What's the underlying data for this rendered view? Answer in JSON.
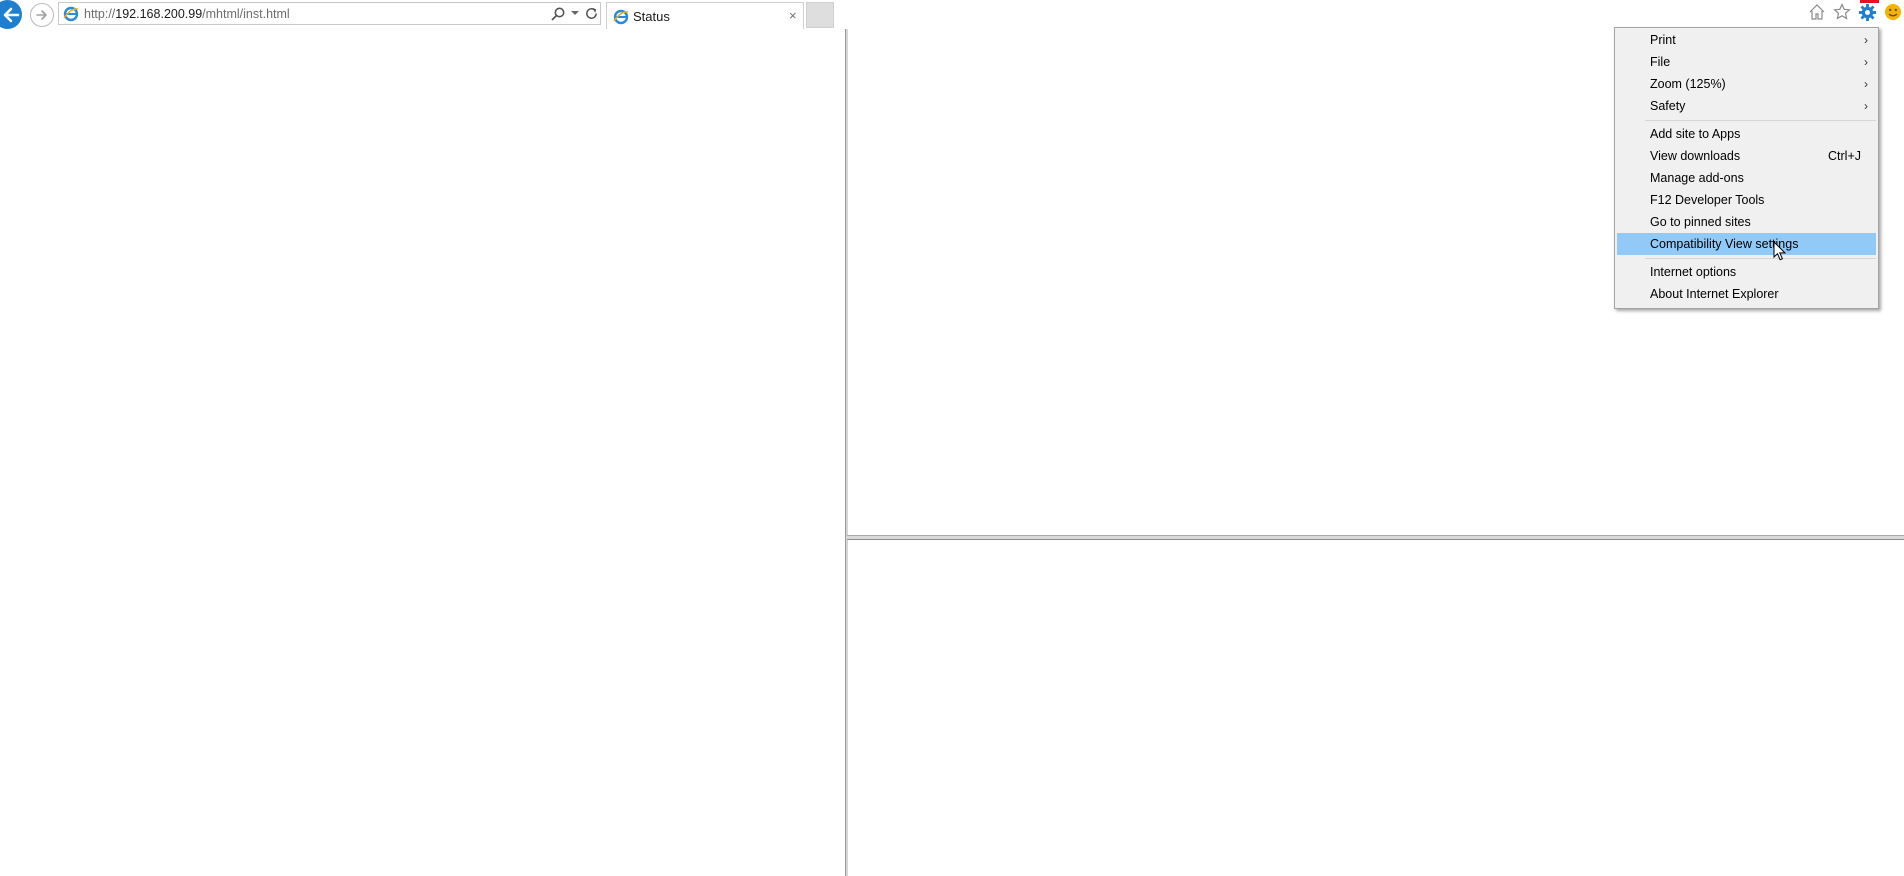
{
  "browser": {
    "address": {
      "url_prefix": "http://",
      "url_host": "192.168.200.99",
      "url_path": "/mhtml/inst.html"
    },
    "tab": {
      "title": "Status",
      "close": "×"
    },
    "icons": [
      "back-arrow-icon",
      "forward-arrow-icon",
      "ie-logo-icon",
      "search-icon",
      "dropdown-icon",
      "refresh-icon",
      "home-icon",
      "favorites-star-icon",
      "tools-gear-icon",
      "feedback-smiley-icon"
    ],
    "accent_color": "#1e7fd0"
  },
  "tools_menu": {
    "items": [
      {
        "label": "Print",
        "submenu": true
      },
      {
        "label": "File",
        "submenu": true
      },
      {
        "label": "Zoom (125%)",
        "submenu": true
      },
      {
        "label": "Safety",
        "submenu": true
      },
      {
        "label": "Add site to Apps"
      },
      {
        "label": "View downloads",
        "shortcut": "Ctrl+J"
      },
      {
        "label": "Manage add-ons"
      },
      {
        "label": "F12 Developer Tools"
      },
      {
        "label": "Go to pinned sites"
      },
      {
        "label": "Compatibility View settings",
        "highlighted": true
      },
      {
        "label": "Internet options"
      },
      {
        "label": "About Internet Explorer"
      }
    ],
    "arrow": "›",
    "highlight_color": "#91c9f7"
  }
}
